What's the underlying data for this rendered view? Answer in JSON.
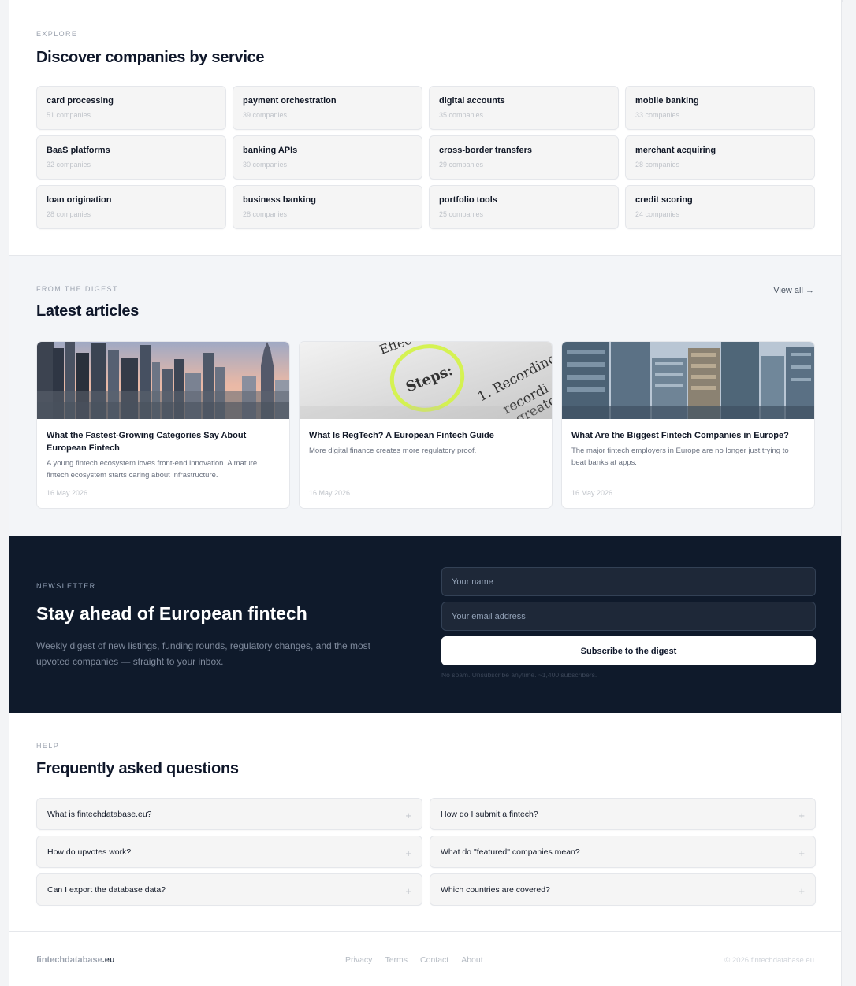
{
  "services": {
    "eyebrow": "EXPLORE",
    "title": "Discover companies by service",
    "items": [
      {
        "name": "card processing",
        "count": "51 companies"
      },
      {
        "name": "payment orchestration",
        "count": "39 companies"
      },
      {
        "name": "digital accounts",
        "count": "35 companies"
      },
      {
        "name": "mobile banking",
        "count": "33 companies"
      },
      {
        "name": "BaaS platforms",
        "count": "32 companies"
      },
      {
        "name": "banking APIs",
        "count": "30 companies"
      },
      {
        "name": "cross-border transfers",
        "count": "29 companies"
      },
      {
        "name": "merchant acquiring",
        "count": "28 companies"
      },
      {
        "name": "loan origination",
        "count": "28 companies"
      },
      {
        "name": "business banking",
        "count": "28 companies"
      },
      {
        "name": "portfolio tools",
        "count": "25 companies"
      },
      {
        "name": "credit scoring",
        "count": "24 companies"
      }
    ]
  },
  "articles": {
    "eyebrow": "FROM THE DIGEST",
    "title": "Latest articles",
    "view_all": "View all →",
    "items": [
      {
        "title": "What the Fastest-Growing Categories Say About European Fintech",
        "excerpt": "A young fintech ecosystem loves front-end innovation. A mature fintech ecosystem starts caring about infrastructure.",
        "date": "16 May 2026",
        "image": "city-skyline"
      },
      {
        "title": "What Is RegTech? A European Fintech Guide",
        "excerpt": "More digital finance creates more regulatory proof.",
        "date": "16 May 2026",
        "image": "highlighted-document",
        "image_words": [
          "Effec",
          "Steps:",
          "1. Recording",
          "recordi",
          "greate"
        ]
      },
      {
        "title": "What Are the Biggest Fintech Companies in Europe?",
        "excerpt": "The major fintech employers in Europe are no longer just trying to beat banks at apps.",
        "date": "16 May 2026",
        "image": "glass-buildings"
      }
    ]
  },
  "newsletter": {
    "eyebrow": "NEWSLETTER",
    "title": "Stay ahead of European fintech",
    "description": "Weekly digest of new listings, funding rounds, regulatory changes, and the most upvoted companies — straight to your inbox.",
    "name_placeholder": "Your name",
    "email_placeholder": "Your email address",
    "button": "Subscribe to the digest",
    "note": "No spam. Unsubscribe anytime. ~1,400 subscribers."
  },
  "faq": {
    "eyebrow": "HELP",
    "title": "Frequently asked questions",
    "items": [
      "What is fintechdatabase.eu?",
      "How do I submit a fintech?",
      "How do upvotes work?",
      "What do \"featured\" companies mean?",
      "Can I export the database data?",
      "Which countries are covered?"
    ],
    "expand_icon": "plus-icon",
    "expand_glyph": "+"
  },
  "footer": {
    "logo_main": "fintechdatabase",
    "logo_tld": ".eu",
    "links": [
      "Privacy",
      "Terms",
      "Contact",
      "About"
    ],
    "copyright": "© 2026 fintechdatabase.eu"
  },
  "colors": {
    "newsletter_bg": "#0f1a2b",
    "highlight_circle": "#d4f24a",
    "page_bg": "#f3f4f6"
  }
}
